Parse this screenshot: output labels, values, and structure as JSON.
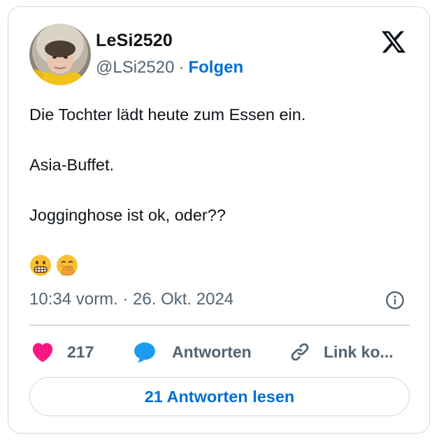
{
  "author": {
    "display_name": "LeSi2520",
    "handle": "@LSi2520",
    "separator": "·",
    "follow_label": "Folgen"
  },
  "tweet": {
    "lines": [
      "Die Tochter lädt heute zum Essen ein.",
      "Asia-Buffet.",
      "Jogginghose ist ok, oder??"
    ],
    "emojis": [
      "grimacing-face",
      "face-with-hand-over-mouth"
    ],
    "timestamp": "10:34 vorm. · 26. Okt. 2024"
  },
  "actions": {
    "like_count": "217",
    "reply_label": "Antworten",
    "link_label": "Link ko..."
  },
  "read_replies_label": "21 Antworten lesen",
  "icons": {
    "brand": "x-logo-icon",
    "info": "info-icon",
    "like": "heart-icon",
    "reply": "speech-bubble-icon",
    "link": "link-icon"
  },
  "colors": {
    "accent": "#006fd6",
    "like": "#f91880",
    "reply": "#1d9bf0",
    "text": "#0f1419",
    "secondary": "#536471",
    "border": "#cfd9de"
  }
}
